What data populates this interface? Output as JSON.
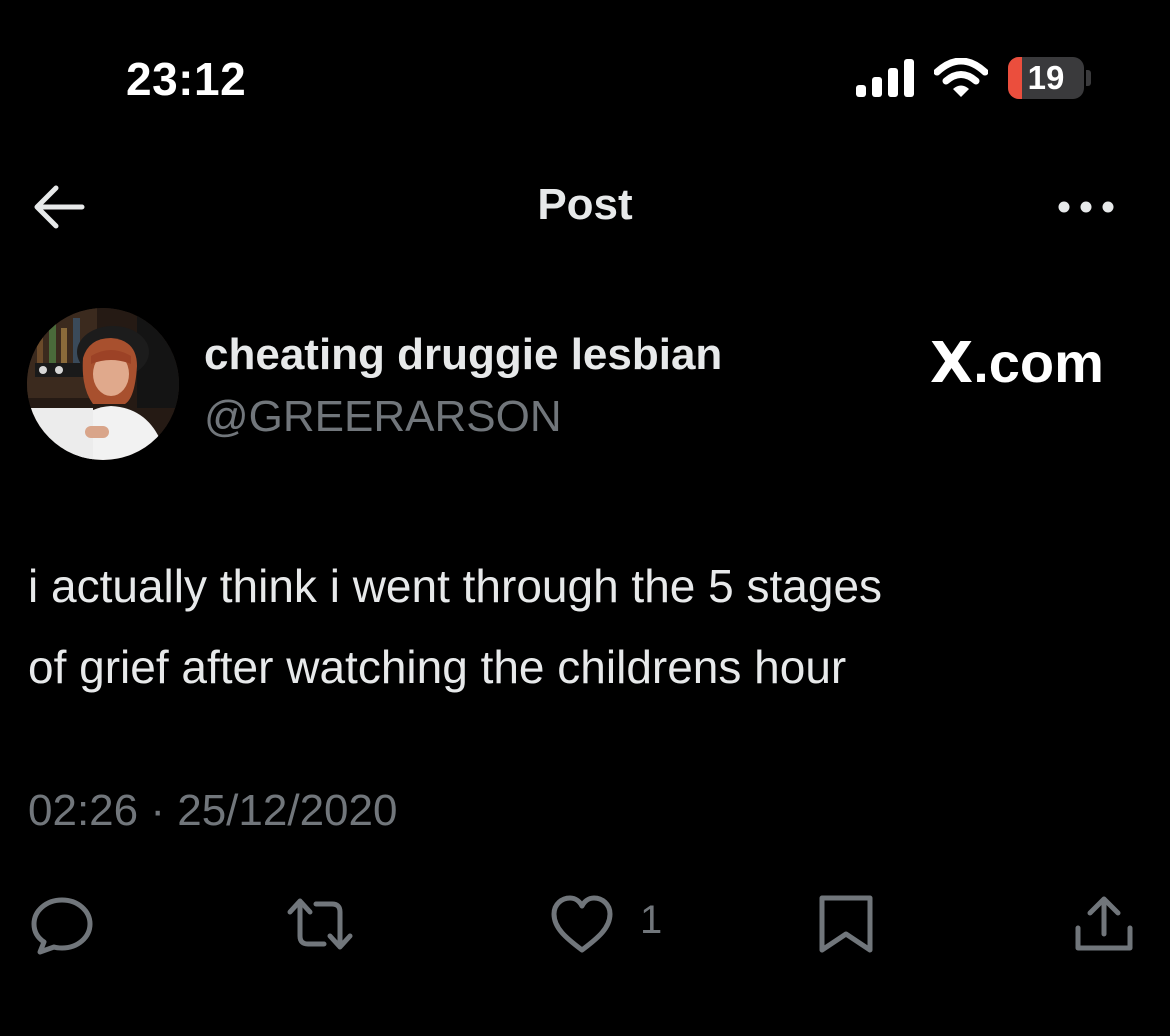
{
  "status_bar": {
    "time": "23:12",
    "battery_level": "19",
    "battery_fraction": 0.19
  },
  "header": {
    "title": "Post"
  },
  "post": {
    "author": {
      "display_name": "cheating druggie lesbian",
      "handle": "@GREERARSON"
    },
    "brand": {
      "logo": "X",
      "suffix": ".com"
    },
    "text_lines": [
      "i actually think i went through the 5 stages",
      "of grief after watching the childrens hour"
    ],
    "time": "02:26",
    "separator": "·",
    "date": "25/12/2020",
    "likes": "1"
  },
  "icons": [
    "back-arrow-icon",
    "more-icon",
    "signal-icon",
    "wifi-icon",
    "battery-icon",
    "reply-icon",
    "repost-icon",
    "like-icon",
    "bookmark-icon",
    "share-icon"
  ],
  "colors": {
    "background": "#000000",
    "primary_text": "#e7e9ea",
    "secondary_text": "#71767b",
    "battery_low": "#eb4e3d"
  }
}
